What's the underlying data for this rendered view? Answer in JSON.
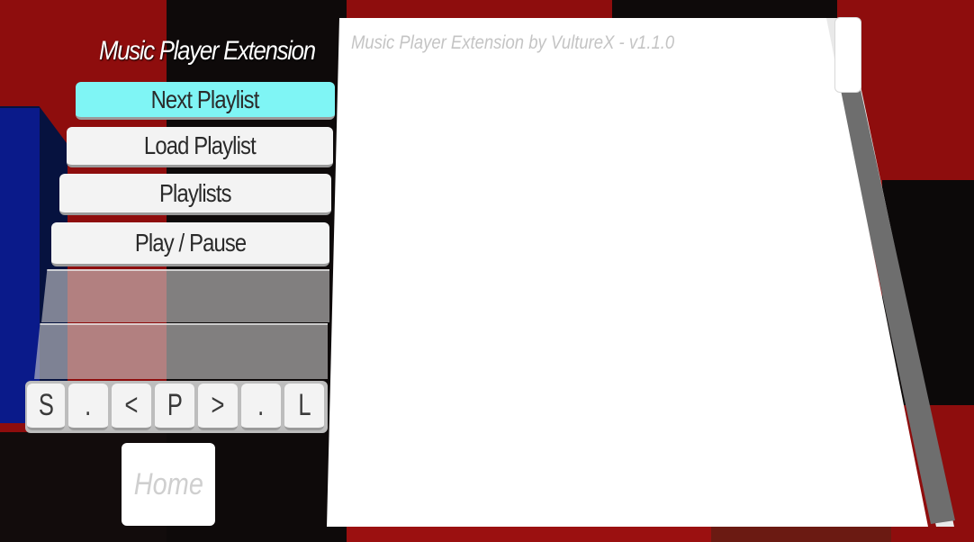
{
  "menu": {
    "title": "Music Player Extension",
    "buttons": {
      "next_playlist": "Next Playlist",
      "load_playlist": "Load Playlist",
      "playlists": "Playlists",
      "play_pause": "Play / Pause"
    },
    "keys": [
      "S",
      ".",
      "<",
      "P",
      ">",
      ".",
      "L"
    ],
    "home": "Home"
  },
  "panel": {
    "header": "Music Player Extension by VultureX - v1.1.0"
  },
  "colors": {
    "highlight": "#7ff5f5",
    "button": "#f3f3f3",
    "background_red": "#8e0d0d",
    "background_black": "#0e0a0a",
    "cube_blue": "#0a1a8a"
  },
  "icons": {
    "prev": "chevron-left-icon",
    "next": "chevron-right-icon"
  }
}
